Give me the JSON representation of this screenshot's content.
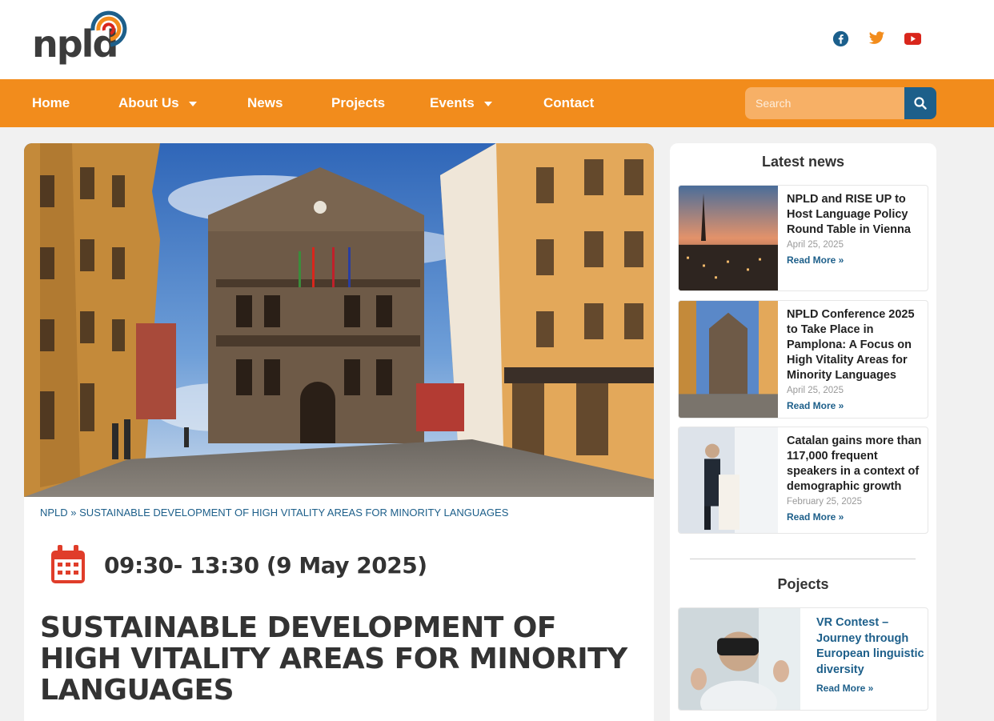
{
  "header": {
    "logo_text": "npld",
    "social": [
      "facebook-icon",
      "twitter-icon",
      "youtube-icon"
    ]
  },
  "colors": {
    "orange": "#f28c1c",
    "blue": "#1d5f8a",
    "calendar_red": "#e03d2a",
    "facebook": "#1b5f8c",
    "twitter": "#f28c1c",
    "youtube": "#d9261c"
  },
  "nav": {
    "items": [
      {
        "label": "Home"
      },
      {
        "label": "About Us"
      },
      {
        "label": "News"
      },
      {
        "label": "Projects"
      },
      {
        "label": "Events"
      },
      {
        "label": "Contact"
      }
    ],
    "search_placeholder": "Search"
  },
  "main": {
    "breadcrumb": "NPLD » SUSTAINABLE DEVELOPMENT OF HIGH VITALITY AREAS FOR MINORITY LANGUAGES",
    "date": "09:30- 13:30 (9 May 2025)",
    "title": "SUSTAINABLE DEVELOPMENT OF HIGH VITALITY AREAS FOR MINORITY LANGUAGES"
  },
  "sidebar": {
    "latest_title": "Latest news",
    "news": [
      {
        "title": "NPLD and RISE UP to Host Language Policy Round Table in Vienna",
        "date": "April 25, 2025",
        "more": "Read More »"
      },
      {
        "title": "NPLD Conference 2025 to Take Place in Pamplona: A Focus on High Vitality Areas for Minority Languages",
        "date": "April 25, 2025",
        "more": "Read More »"
      },
      {
        "title": "Catalan gains more than 117,000 frequent speakers in a context of demographic growth",
        "date": "February 25, 2025",
        "more": "Read More »"
      }
    ],
    "projects_title": "Pojects",
    "projects": [
      {
        "title": "VR Contest – Journey through European linguistic diversity",
        "more": "Read More »"
      }
    ]
  }
}
